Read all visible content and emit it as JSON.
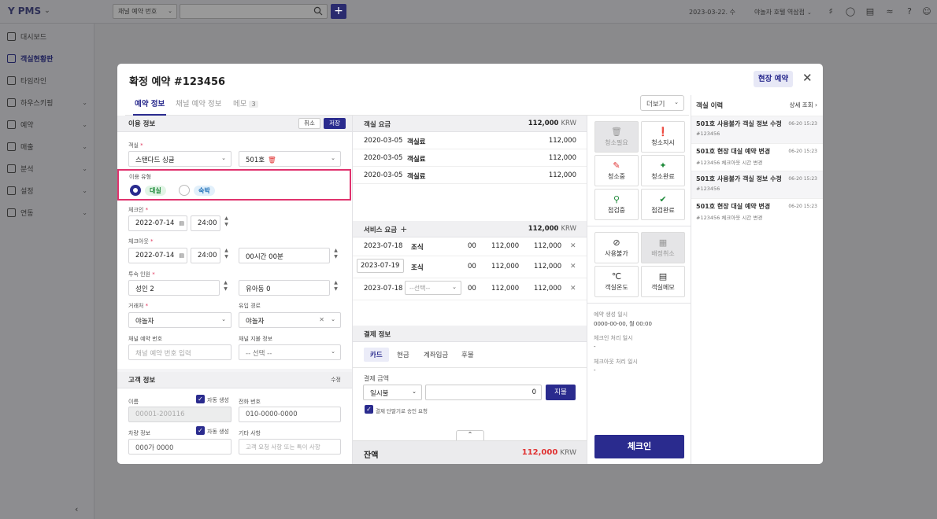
{
  "topbar": {
    "app_name": "PMS",
    "channel_select": "채널 예약 번호",
    "search_placeholder": "",
    "date": "2023-03-22. 수",
    "hotel": "야놀자 호텔 역삼점"
  },
  "sidebar": {
    "items": [
      {
        "label": "대시보드",
        "icon": "dashboard-icon",
        "expandable": false,
        "active": false
      },
      {
        "label": "객실현황판",
        "icon": "room-board-icon",
        "expandable": false,
        "active": true
      },
      {
        "label": "타임라인",
        "icon": "timeline-icon",
        "expandable": false,
        "active": false
      },
      {
        "label": "하우스키핑",
        "icon": "housekeeping-icon",
        "expandable": true,
        "active": false
      },
      {
        "label": "예약",
        "icon": "reservation-icon",
        "expandable": true,
        "active": false
      },
      {
        "label": "매출",
        "icon": "sales-icon",
        "expandable": true,
        "active": false
      },
      {
        "label": "분석",
        "icon": "analytics-icon",
        "expandable": true,
        "active": false
      },
      {
        "label": "설정",
        "icon": "settings-icon",
        "expandable": true,
        "active": false
      },
      {
        "label": "연동",
        "icon": "link-icon",
        "expandable": true,
        "active": false
      }
    ]
  },
  "modal": {
    "title": "확정 예약 #123456",
    "badge": "현장 예약",
    "tabs": [
      {
        "label": "예약 정보",
        "count": ""
      },
      {
        "label": "채널 예약 정보",
        "count": ""
      },
      {
        "label": "메모",
        "count": "3"
      }
    ],
    "more_label": "더보기",
    "usage": {
      "header": "이용 정보",
      "cancel": "취소",
      "save": "저장",
      "room_label": "객실",
      "room_type": "스탠다드 싱글",
      "room_no": "501호",
      "usage_type_label": "이용 유형",
      "usage_day": "대실",
      "usage_stay": "숙박",
      "checkin_label": "체크인",
      "checkin_date": "2022-07-14",
      "checkin_time": "24:00",
      "checkout_label": "체크아웃",
      "checkout_date": "2022-07-14",
      "checkout_time": "24:00",
      "duration": "00시간 00분",
      "guests_label": "투숙 인원",
      "adults": "성인 2",
      "children": "유아동 0",
      "client_label": "거래처",
      "client": "야놀자",
      "inflow_label": "유입 경로",
      "inflow": "야놀자",
      "channel_no_label": "채널 예약 번호",
      "channel_no_placeholder": "채널 예약 번호 입력",
      "channel_pay_label": "채널 지불 정보",
      "channel_pay": "-- 선택 --"
    },
    "guest": {
      "header": "고객 정보",
      "edit": "수정",
      "name_label": "이름",
      "auto_gen": "자동 생성",
      "name_value": "00001-200116",
      "phone_label": "전화 번호",
      "phone_placeholder": "010-0000-0000",
      "vehicle_label": "차량 정보",
      "vehicle_placeholder": "000가 0000",
      "etc_label": "기타 사항",
      "etc_placeholder": "고객 요청 사항 또는 특이 사항"
    },
    "room_charges": {
      "header": "객실 요금",
      "total": "112,000",
      "currency": "KRW",
      "rows": [
        {
          "date": "2020-03-05",
          "name": "객실료",
          "amount": "112,000"
        },
        {
          "date": "2020-03-05",
          "name": "객실료",
          "amount": "112,000"
        },
        {
          "date": "2020-03-05",
          "name": "객실료",
          "amount": "112,000"
        }
      ]
    },
    "service_charges": {
      "header": "서비스 요금",
      "total": "112,000",
      "currency": "KRW",
      "rows": [
        {
          "date": "2023-07-18",
          "name": "조식",
          "qty": "00",
          "price": "112,000",
          "amount": "112,000"
        },
        {
          "date": "2023-07-19",
          "name": "조식",
          "qty": "00",
          "price": "112,000",
          "amount": "112,000"
        },
        {
          "date": "2023-07-18",
          "name": "--선택--",
          "qty": "00",
          "price": "112,000",
          "amount": "112,000"
        }
      ]
    },
    "payment": {
      "header": "결제 정보",
      "tabs": [
        "카드",
        "현금",
        "계좌입금",
        "후불"
      ],
      "amount_label": "결제 금액",
      "method": "일시불",
      "amount": "0",
      "pay_btn": "지불",
      "terminal_label": "결제 단말기로 승인 요청"
    },
    "balance": {
      "label": "잔액",
      "amount": "112,000",
      "currency": "KRW"
    },
    "room_actions": [
      {
        "label": "청소필요",
        "icon": "trash-icon",
        "disabled": true
      },
      {
        "label": "청소지시",
        "icon": "alert-icon",
        "disabled": false
      },
      {
        "label": "청소중",
        "icon": "broom-icon",
        "disabled": false
      },
      {
        "label": "청소완료",
        "icon": "sparkle-icon",
        "disabled": false
      },
      {
        "label": "점검중",
        "icon": "search-icon",
        "disabled": false
      },
      {
        "label": "점검완료",
        "icon": "check-circle-icon",
        "disabled": false
      },
      {
        "label": "사용불가",
        "icon": "block-icon",
        "disabled": false
      },
      {
        "label": "배정취소",
        "icon": "unassign-icon",
        "disabled": true
      },
      {
        "label": "객실온도",
        "icon": "thermometer-icon",
        "disabled": false
      },
      {
        "label": "객실메모",
        "icon": "memo-icon",
        "disabled": false
      }
    ],
    "meta": {
      "created_label": "예약 생성 일시",
      "created_value": "0000-00-00, 월 00:00",
      "checkin_proc_label": "체크인 처리 일시",
      "checkin_proc_value": "-",
      "checkout_proc_label": "체크아웃 처리 일시",
      "checkout_proc_value": "-"
    },
    "checkin_btn": "체크인",
    "history": {
      "header": "객실 이력",
      "detail": "상세 조회",
      "items": [
        {
          "title": "501호  사용불가 객실 정보 수정",
          "sub": "#123456",
          "time": "06-20 15:23"
        },
        {
          "title": "501호  현장 대실 예약 변경",
          "sub": "#123456  체크아웃 시간 변경",
          "time": "06-20 15:23"
        },
        {
          "title": "501호  사용불가 객실 정보 수정",
          "sub": "#123456",
          "time": "06-20 15:23"
        },
        {
          "title": "501호  현장 대실 예약 변경",
          "sub": "#123456  체크아웃 시간 변경",
          "time": "06-20 15:23"
        }
      ]
    }
  }
}
